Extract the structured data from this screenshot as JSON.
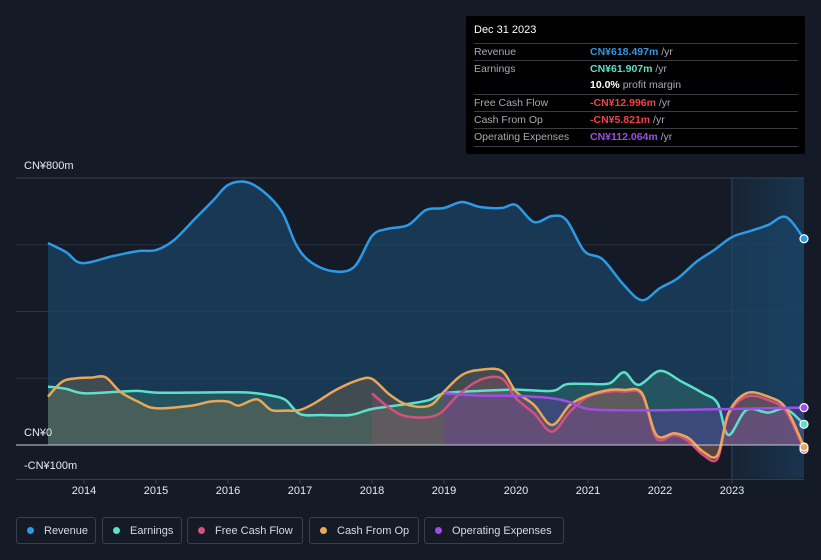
{
  "tooltip": {
    "date": "Dec 31 2023",
    "rows": [
      {
        "label": "Revenue",
        "value": "CN¥618.497m",
        "unit": " /yr",
        "color": "#2d9ae6"
      },
      {
        "label": "Earnings",
        "value": "CN¥61.907m",
        "unit": " /yr",
        "color": "#5de0c9"
      },
      {
        "label": "",
        "value": "10.0%",
        "unit": " profit margin",
        "color": "#ffffff"
      },
      {
        "label": "Free Cash Flow",
        "value": "-CN¥12.996m",
        "unit": " /yr",
        "color": "#f0414a"
      },
      {
        "label": "Cash From Op",
        "value": "-CN¥5.821m",
        "unit": " /yr",
        "color": "#f0414a"
      },
      {
        "label": "Operating Expenses",
        "value": "CN¥112.064m",
        "unit": " /yr",
        "color": "#9d4ee6"
      }
    ]
  },
  "legend": [
    {
      "label": "Revenue",
      "color": "#2d9ae6"
    },
    {
      "label": "Earnings",
      "color": "#5de0c9"
    },
    {
      "label": "Free Cash Flow",
      "color": "#d6507f"
    },
    {
      "label": "Cash From Op",
      "color": "#e8a857"
    },
    {
      "label": "Operating Expenses",
      "color": "#9d4ee6"
    }
  ],
  "chart_data": {
    "type": "area",
    "title": "",
    "xlabel": "",
    "ylabel": "",
    "y_tick_labels": [
      "CN¥800m",
      "CN¥0",
      "-CN¥100m"
    ],
    "y_ticks": [
      800,
      0,
      -100
    ],
    "ylim": [
      -100,
      800
    ],
    "xlim": [
      2013.5,
      2024.0
    ],
    "x_ticks": [
      2014,
      2015,
      2016,
      2017,
      2018,
      2019,
      2020,
      2021,
      2022,
      2023
    ],
    "x_tick_labels": [
      "2014",
      "2015",
      "2016",
      "2017",
      "2018",
      "2019",
      "2020",
      "2021",
      "2022",
      "2023"
    ],
    "gridlines": [
      800,
      600,
      400,
      200
    ],
    "grid": true,
    "forecast_start": 2023.0,
    "legend_position": "bottom",
    "series": [
      {
        "name": "Revenue",
        "color": "#2d9ae6",
        "x": [
          2013.5,
          2013.75,
          2013.97,
          2014.4,
          2014.75,
          2015.0,
          2015.25,
          2015.55,
          2015.8,
          2016.0,
          2016.25,
          2016.5,
          2016.75,
          2016.95,
          2017.15,
          2017.45,
          2017.75,
          2018.0,
          2018.2,
          2018.5,
          2018.75,
          2019.0,
          2019.25,
          2019.5,
          2019.8,
          2020.0,
          2020.25,
          2020.5,
          2020.7,
          2020.95,
          2021.2,
          2021.5,
          2021.75,
          2022.0,
          2022.25,
          2022.5,
          2022.75,
          2023.0,
          2023.25,
          2023.5,
          2023.75,
          2024.0
        ],
        "y": [
          605,
          578,
          545,
          566,
          581,
          584,
          614,
          680,
          734,
          779,
          788,
          758,
          698,
          599,
          548,
          521,
          533,
          626,
          647,
          659,
          704,
          710,
          728,
          713,
          710,
          719,
          668,
          686,
          674,
          581,
          557,
          479,
          434,
          470,
          500,
          548,
          584,
          623,
          641,
          659,
          683,
          618
        ]
      },
      {
        "name": "Earnings",
        "color": "#5de0c9",
        "x": [
          2013.5,
          2013.75,
          2014.0,
          2014.5,
          2014.75,
          2015.0,
          2015.5,
          2016.0,
          2016.3,
          2016.6,
          2016.8,
          2017.0,
          2017.3,
          2017.7,
          2018.0,
          2018.5,
          2018.8,
          2019.0,
          2019.5,
          2020.0,
          2020.5,
          2020.7,
          2021.0,
          2021.3,
          2021.5,
          2021.7,
          2022.0,
          2022.3,
          2022.6,
          2022.8,
          2022.95,
          2023.2,
          2023.5,
          2023.75,
          2024.0
        ],
        "y": [
          175,
          168,
          155,
          160,
          162,
          157,
          157,
          158,
          157,
          148,
          135,
          93,
          90,
          90,
          108,
          123,
          135,
          155,
          162,
          166,
          162,
          182,
          183,
          185,
          218,
          180,
          222,
          190,
          155,
          125,
          30,
          105,
          97,
          108,
          62
        ]
      },
      {
        "name": "Free Cash Flow",
        "color": "#d6507f",
        "x": [
          2018.0,
          2018.25,
          2018.5,
          2018.9,
          2019.2,
          2019.5,
          2019.8,
          2020.0,
          2020.25,
          2020.5,
          2020.75,
          2021.0,
          2021.3,
          2021.5,
          2021.75,
          2021.95,
          2022.2,
          2022.4,
          2022.6,
          2022.8,
          2022.95,
          2023.2,
          2023.5,
          2023.75,
          2024.0
        ],
        "y": [
          155,
          110,
          85,
          90,
          150,
          195,
          200,
          140,
          95,
          40,
          100,
          145,
          160,
          160,
          150,
          20,
          30,
          10,
          -30,
          -40,
          90,
          145,
          135,
          100,
          -13
        ]
      },
      {
        "name": "Cash From Op",
        "color": "#e8a857",
        "x": [
          2013.5,
          2013.7,
          2013.9,
          2014.1,
          2014.3,
          2014.5,
          2014.75,
          2015.0,
          2015.5,
          2015.75,
          2016.0,
          2016.15,
          2016.4,
          2016.6,
          2016.8,
          2017.0,
          2017.2,
          2017.5,
          2017.8,
          2018.0,
          2018.25,
          2018.5,
          2018.8,
          2019.0,
          2019.25,
          2019.5,
          2019.8,
          2020.0,
          2020.25,
          2020.5,
          2020.75,
          2021.0,
          2021.3,
          2021.5,
          2021.75,
          2021.95,
          2022.2,
          2022.4,
          2022.6,
          2022.8,
          2022.95,
          2023.2,
          2023.5,
          2023.75,
          2024.0
        ],
        "y": [
          145,
          190,
          200,
          202,
          203,
          160,
          130,
          110,
          118,
          130,
          130,
          118,
          137,
          105,
          103,
          105,
          125,
          165,
          194,
          198,
          150,
          120,
          118,
          160,
          210,
          225,
          222,
          160,
          120,
          60,
          120,
          148,
          165,
          165,
          155,
          30,
          35,
          20,
          -20,
          -30,
          95,
          155,
          145,
          110,
          -6
        ]
      },
      {
        "name": "Operating Expenses",
        "color": "#9d4ee6",
        "x": [
          2019.0,
          2019.5,
          2020.0,
          2020.5,
          2020.75,
          2021.0,
          2021.5,
          2022.0,
          2022.5,
          2023.0,
          2023.5,
          2024.0
        ],
        "y": [
          155,
          148,
          147,
          140,
          128,
          108,
          104,
          104,
          106,
          108,
          110,
          112
        ]
      }
    ]
  }
}
